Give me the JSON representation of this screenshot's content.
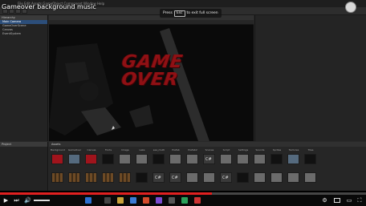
{
  "video": {
    "title": "Gameover background music",
    "fullscreen_prefix": "Press",
    "fullscreen_key": "Esc",
    "fullscreen_suffix": "to exit full screen",
    "progress_fraction": 0.58
  },
  "editor": {
    "menu": "File  Edit  Assets  GameObject  Component  Window  Help",
    "hierarchy_tab": "Hierarchy",
    "hierarchy_items": [
      "Main Camera",
      "GameOverScene",
      "Canvas",
      "EventSystem"
    ],
    "scene_text": "GAME OVER",
    "project_tab": "Project",
    "assets_breadcrumb": "Assets"
  },
  "assets_row1": [
    "Background",
    "GameOver",
    "Canvas",
    "Fonts",
    "Image",
    "Lake",
    "sea_multi",
    "Prefab",
    "Prefab2",
    "Scenes",
    "Script",
    "Settings",
    "Sounds",
    "Sprites",
    "Textures",
    "Tiles"
  ],
  "icons": [
    "play-icon",
    "next-icon",
    "volume-icon",
    "settings-icon",
    "fullscreen-icon"
  ],
  "colors": {
    "accent": "#e02020",
    "game_over_text": "#8f1014",
    "selection": "#2c4e7a"
  }
}
